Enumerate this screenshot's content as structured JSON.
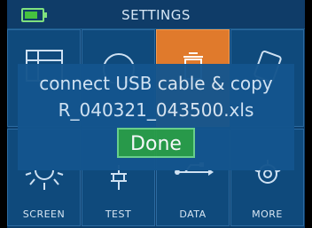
{
  "header": {
    "title": "SETTINGS",
    "battery_level": 0.75
  },
  "dialog": {
    "line1": "connect USB cable & copy",
    "line2": "R_040321_043500.xls",
    "done_label": "Done"
  },
  "menu": {
    "items": [
      {
        "label": "SCREEN"
      },
      {
        "label": "TEST"
      },
      {
        "label": "DATA",
        "selected": true
      },
      {
        "label": "MORE"
      }
    ]
  },
  "colors": {
    "background": "#0d3e6b",
    "selected_tile": "#e07a2c",
    "done_button": "#2a9d49",
    "battery": "#46c23f"
  }
}
